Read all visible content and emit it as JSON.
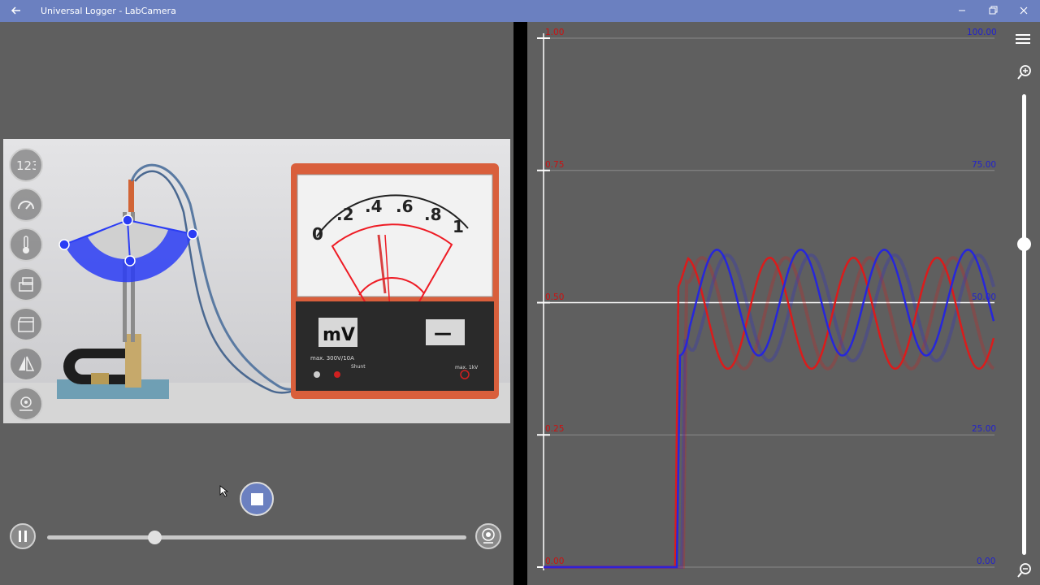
{
  "window": {
    "title": "Universal Logger - LabCamera"
  },
  "meter": {
    "scale_labels": [
      "0",
      ".2",
      ".4",
      ".6",
      ".8",
      "1"
    ],
    "range_unit": "mV",
    "current_mode": "—",
    "input_spec": "max. 300V/10A",
    "shunt_label": "Shunt",
    "max_voltage": "max. 1kV"
  },
  "graph": {
    "left_axis": [
      "1.00",
      "0.75",
      "0.50",
      "0.25",
      "0.00"
    ],
    "right_axis": [
      "100.00",
      "75.00",
      "50.00",
      "25.00",
      "0.00"
    ],
    "colors": {
      "left": "#cc1111",
      "right": "#2222cc"
    }
  },
  "chart_data": {
    "type": "line",
    "series": [
      {
        "color": "#e01818",
        "values_summary": "step at ~0.25 of time to 0.50, then oscillation between 0.37 and 0.58"
      },
      {
        "color": "#2424e0",
        "values_summary": "step at ~0.25 of time to 0.40, then oscillation between 0.40 and 0.60"
      }
    ],
    "ylim_left": [
      0,
      1
    ],
    "ylim_right": [
      0,
      100
    ]
  },
  "playback": {
    "progress": 0.255
  }
}
